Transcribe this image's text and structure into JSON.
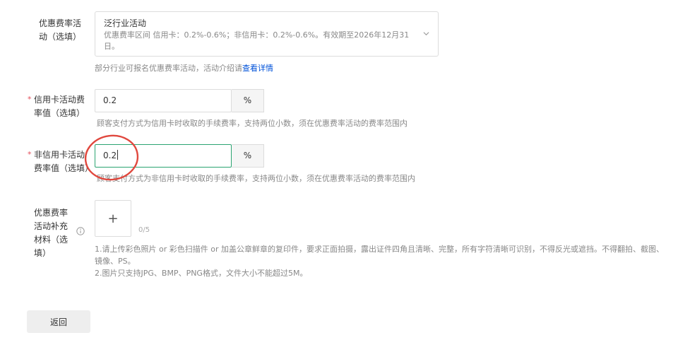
{
  "promo_activity": {
    "label": "优惠费率活动（选填）",
    "selected_title": "泛行业活动",
    "selected_desc": "优惠费率区间 信用卡：0.2%-0.6%；非信用卡：0.2%-0.6%。有效期至2026年12月31日。",
    "help_text": "部分行业可报名优惠费率活动，活动介绍请",
    "help_link": "查看详情"
  },
  "credit_rate": {
    "required_mark": "*",
    "label": "信用卡活动费率值（选填）",
    "value": "0.2",
    "unit": "%",
    "help": "顾客支付方式为信用卡时收取的手续费率，支持两位小数，须在优惠费率活动的费率范围内"
  },
  "noncredit_rate": {
    "required_mark": "*",
    "label": "非信用卡活动费率值（选填）",
    "value": "0.2",
    "unit": "%",
    "help": "顾客支付方式为非信用卡时收取的手续费率，支持两位小数，须在优惠费率活动的费率范围内"
  },
  "materials": {
    "label": "优惠费率活动补充材料（选填）",
    "upload_symbol": "+",
    "count": "0/5",
    "note1": "1.请上传彩色照片 or 彩色扫描件 or 加盖公章鲜章的复印件，要求正面拍摄，露出证件四角且清晰、完整，所有字符清晰可识别，不得反光或遮挡。不得翻拍、截图、镜像、PS。",
    "note2": "2.图片只支持JPG、BMP、PNG格式，文件大小不能超过5M。"
  },
  "back_button": "返回",
  "colors": {
    "focus_border": "#2ba471",
    "annotation_circle": "#e0483e",
    "link": "#0052d9",
    "required": "#e34d59"
  }
}
